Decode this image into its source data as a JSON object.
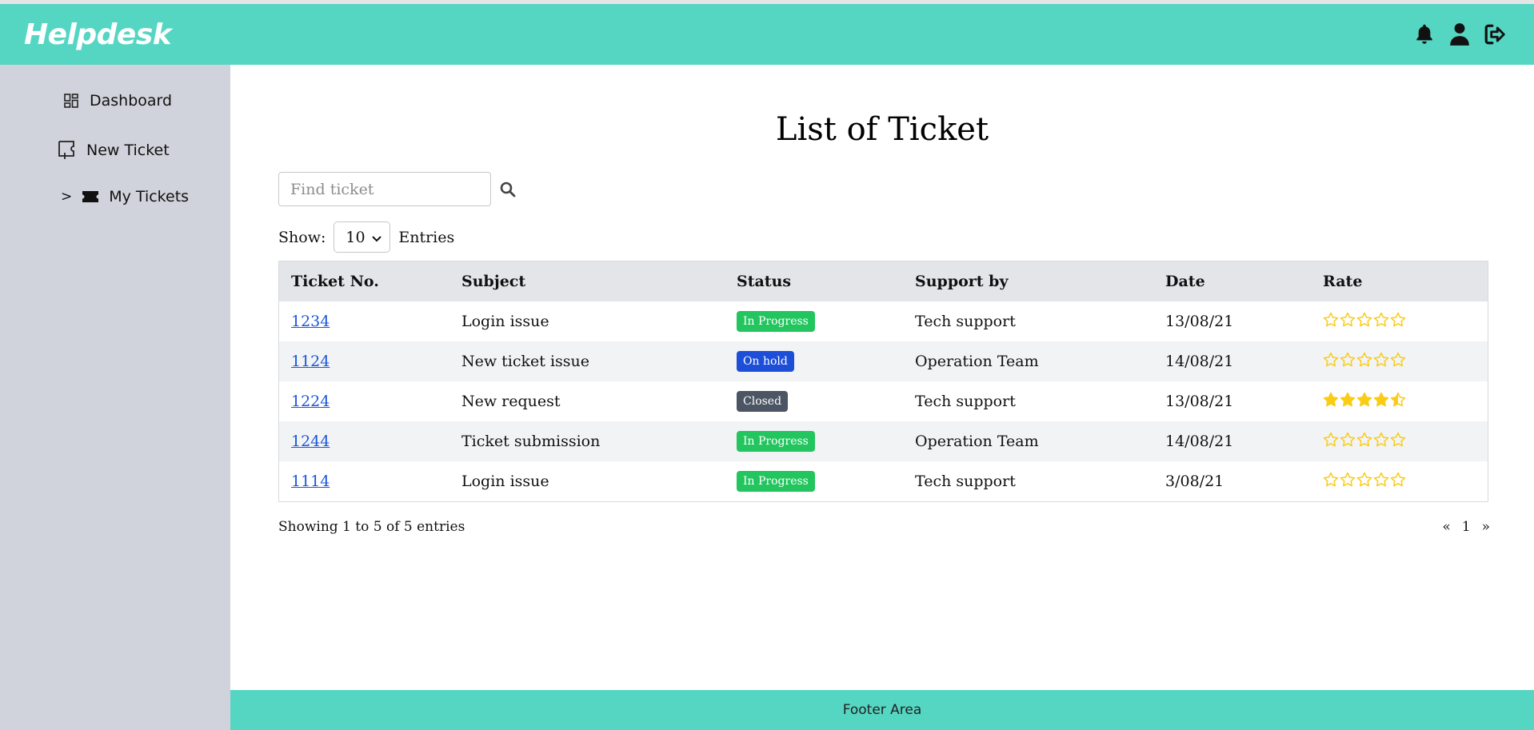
{
  "header": {
    "brand": "Helpdesk",
    "bg_color": "#55d6c2",
    "icons": [
      "bell-icon",
      "user-icon",
      "logout-icon"
    ]
  },
  "sidebar": {
    "bg_color": "#d0d3db",
    "items": [
      {
        "label": "Dashboard",
        "icon": "dashboard-icon"
      },
      {
        "label": "New Ticket",
        "icon": "ticket-add-icon"
      },
      {
        "label": "My Tickets",
        "icon": "ticket-icon",
        "caret": ">"
      }
    ]
  },
  "main": {
    "title": "List of Ticket",
    "search": {
      "placeholder": "Find ticket",
      "value": ""
    },
    "show": {
      "label": "Show:",
      "value": "10",
      "suffix": "Entries"
    },
    "table": {
      "headers": [
        "Ticket No.",
        "Subject",
        "Status",
        "Support by",
        "Date",
        "Rate"
      ],
      "rows": [
        {
          "ticket": "1234",
          "subject": "Login issue",
          "status": "In Progress",
          "status_color": "#22c55e",
          "support": "Tech support",
          "date": "13/08/21",
          "rating": 0
        },
        {
          "ticket": "1124",
          "subject": "New ticket issue",
          "status": "On hold",
          "status_color": "#1d4ed8",
          "support": "Operation Team",
          "date": "14/08/21",
          "rating": 0
        },
        {
          "ticket": "1224",
          "subject": "New request",
          "status": "Closed",
          "status_color": "#4b5563",
          "support": "Tech support",
          "date": "13/08/21",
          "rating": 4.5
        },
        {
          "ticket": "1244",
          "subject": "Ticket submission",
          "status": "In Progress",
          "status_color": "#22c55e",
          "support": "Operation Team",
          "date": "14/08/21",
          "rating": 0
        },
        {
          "ticket": "1114",
          "subject": "Login issue",
          "status": "In Progress",
          "status_color": "#22c55e",
          "support": "Tech support",
          "date": "3/08/21",
          "rating": 0
        }
      ]
    },
    "info": "Showing 1 to 5 of 5 entries",
    "pager": {
      "prev": "«",
      "page": "1",
      "next": "»"
    }
  },
  "footer": {
    "text": "Footer Area"
  },
  "colors": {
    "star": "#facc15"
  }
}
